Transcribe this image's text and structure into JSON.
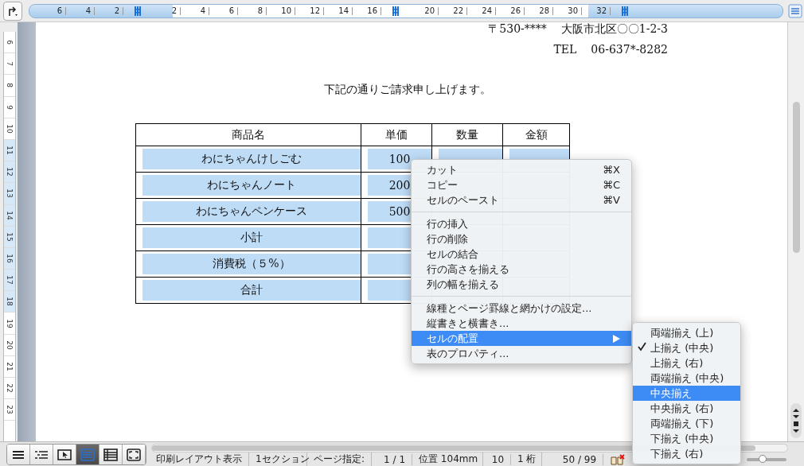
{
  "top_ruler": {
    "marks": [
      {
        "kind": "number",
        "label": "6"
      },
      {
        "kind": "number",
        "label": "4"
      },
      {
        "kind": "number",
        "label": "2"
      },
      {
        "kind": "tab_stop"
      },
      {
        "kind": "number",
        "label": "2"
      },
      {
        "kind": "number",
        "label": "4"
      },
      {
        "kind": "number",
        "label": "6"
      },
      {
        "kind": "number",
        "label": "8"
      },
      {
        "kind": "number",
        "label": "10"
      },
      {
        "kind": "number",
        "label": "12"
      },
      {
        "kind": "number",
        "label": "14"
      },
      {
        "kind": "number",
        "label": "16"
      },
      {
        "kind": "tab_stop"
      },
      {
        "kind": "number",
        "label": "20"
      },
      {
        "kind": "number",
        "label": "22"
      },
      {
        "kind": "number",
        "label": "24"
      },
      {
        "kind": "number",
        "label": "26"
      },
      {
        "kind": "number",
        "label": "28"
      },
      {
        "kind": "number",
        "label": "30"
      },
      {
        "kind": "number",
        "label": "32"
      },
      {
        "kind": "tab_stop"
      }
    ]
  },
  "left_ruler": {
    "labels": [
      "6",
      "7",
      "8",
      "9",
      "10",
      "11",
      "12",
      "13",
      "14",
      "15",
      "16",
      "17",
      "18",
      "19",
      "20",
      "21",
      "22",
      "23"
    ]
  },
  "document": {
    "address": "〒530-****",
    "address_2": "大阪市北区〇〇1-2-3",
    "tel_label": "TEL",
    "tel": "06-637*-8282",
    "greeting": "下記の通りご請求申し上げます。",
    "table": {
      "columns": [
        "商品名",
        "単価",
        "数量",
        "金額"
      ],
      "rows": [
        {
          "cells": [
            "わにちゃんけしごむ",
            "100",
            "",
            ""
          ],
          "selected": true
        },
        {
          "cells": [
            "わにちゃんノート",
            "200",
            "",
            ""
          ],
          "selected": true
        },
        {
          "cells": [
            "わにちゃんペンケース",
            "500",
            "",
            ""
          ],
          "selected": true
        },
        {
          "cells": [
            "小計",
            "",
            "",
            ""
          ],
          "selected": true
        },
        {
          "cells": [
            "消費税（５%）",
            "",
            "",
            ""
          ],
          "selected": true
        },
        {
          "cells": [
            "合計",
            "",
            "",
            ""
          ],
          "selected": true
        }
      ]
    }
  },
  "context_menu": {
    "items": [
      {
        "kind": "item",
        "label": "カット",
        "shortcut": "⌘X",
        "selected": false
      },
      {
        "kind": "item",
        "label": "コピー",
        "shortcut": "⌘C",
        "selected": false
      },
      {
        "kind": "item",
        "label": "セルのペースト",
        "shortcut": "⌘V",
        "selected": false
      },
      {
        "kind": "separator"
      },
      {
        "kind": "item",
        "label": "行の挿入",
        "selected": false
      },
      {
        "kind": "item",
        "label": "行の削除",
        "selected": false
      },
      {
        "kind": "item",
        "label": "セルの結合",
        "selected": false
      },
      {
        "kind": "item",
        "label": "行の高さを揃える",
        "selected": false
      },
      {
        "kind": "item",
        "label": "列の幅を揃える",
        "selected": false
      },
      {
        "kind": "separator"
      },
      {
        "kind": "item",
        "label": "線種とページ罫線と網かけの設定...",
        "selected": false
      },
      {
        "kind": "item",
        "label": "縦書きと横書き...",
        "selected": false
      },
      {
        "kind": "submenu",
        "label": "セルの配置",
        "selected": true
      },
      {
        "kind": "item",
        "label": "表のプロパティ...",
        "selected": false
      }
    ]
  },
  "submenu": {
    "items": [
      {
        "label": "両端揃え (上)",
        "checked": false,
        "selected": false
      },
      {
        "label": "上揃え (中央)",
        "checked": true,
        "selected": false
      },
      {
        "label": "上揃え (右)",
        "checked": false,
        "selected": false
      },
      {
        "label": "両端揃え (中央)",
        "checked": false,
        "selected": false
      },
      {
        "label": "中央揃え",
        "checked": false,
        "selected": true
      },
      {
        "label": "中央揃え (右)",
        "checked": false,
        "selected": false
      },
      {
        "label": "両端揃え (下)",
        "checked": false,
        "selected": false
      },
      {
        "label": "下揃え (中央)",
        "checked": false,
        "selected": false
      },
      {
        "label": "下揃え (右)",
        "checked": false,
        "selected": false
      }
    ]
  },
  "view_buttons": [
    {
      "kind": "draft",
      "selected": false
    },
    {
      "kind": "outline",
      "selected": false
    },
    {
      "kind": "publishing",
      "selected": false
    },
    {
      "kind": "print",
      "selected": true
    },
    {
      "kind": "notebook",
      "selected": false
    },
    {
      "kind": "fullscreen",
      "selected": false
    }
  ],
  "zoom": {
    "level": 0.4
  },
  "status_bar": {
    "view": "印刷レイアウト表示",
    "section": "1セクション",
    "page_label": "ページ指定:",
    "page": "1 / 1",
    "position": "位置 104mm",
    "line": "10",
    "column": "1 桁",
    "words": "50 / 99"
  }
}
